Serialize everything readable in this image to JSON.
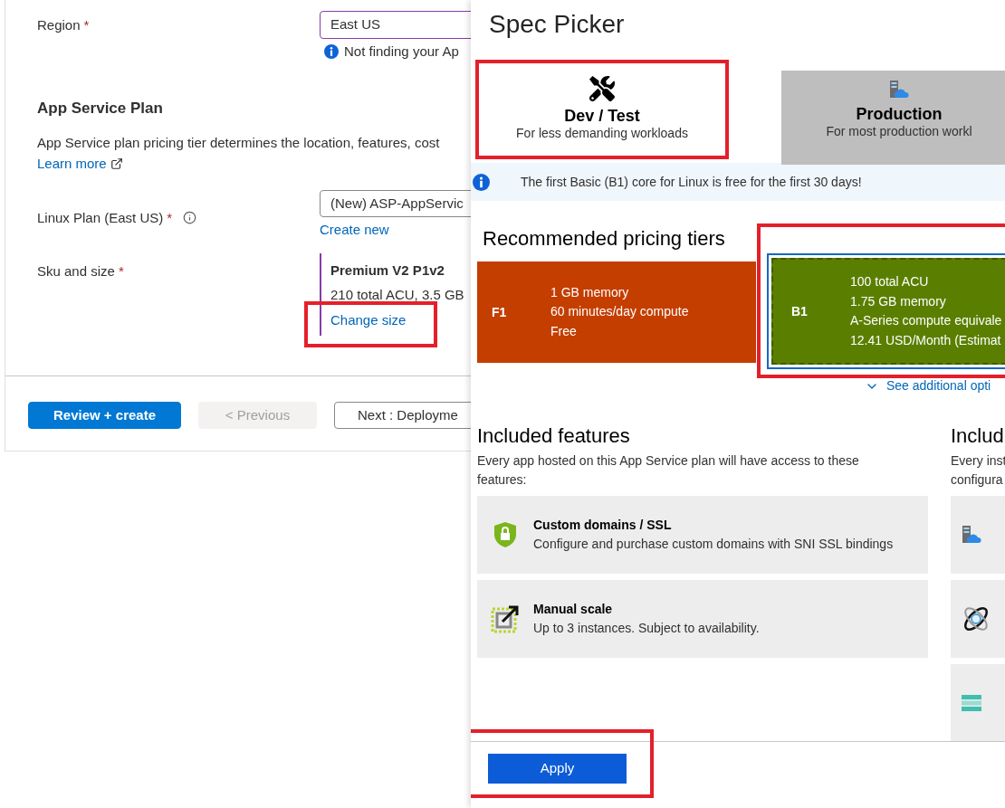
{
  "form": {
    "region": {
      "label": "Region",
      "required_mark": "*",
      "value": "East US",
      "hint": "Not finding your Ap"
    },
    "plan_section": {
      "title": "App Service Plan",
      "description": "App Service plan pricing tier determines the location, features, cost",
      "learn_more": "Learn more"
    },
    "linux_plan": {
      "label": "Linux Plan (East US)",
      "required_mark": "*",
      "value": "(New) ASP-AppServic",
      "link": "Create new"
    },
    "sku": {
      "label": "Sku and size",
      "required_mark": "*",
      "name": "Premium V2 P1v2",
      "detail": "210 total ACU, 3.5 GB",
      "link": {
        "label": "Change size",
        "highlighted": true
      }
    },
    "buttons": [
      {
        "label": "Review + create",
        "kind": "primary",
        "disabled": false
      },
      {
        "label": "< Previous",
        "kind": "secondary",
        "disabled": true
      },
      {
        "label": "Next : Deployme",
        "kind": "outline",
        "disabled": false
      }
    ]
  },
  "spec_picker": {
    "title": "Spec Picker",
    "tabs": [
      {
        "label": "Dev / Test",
        "sublabel": "For less demanding workloads",
        "kind": "tools",
        "selected": true,
        "highlighted": true
      },
      {
        "label": "Production",
        "sublabel": "For most production workl",
        "kind": "server-cloud",
        "selected": false,
        "highlighted": false
      }
    ],
    "notice": "The first Basic (B1) core for Linux is free for the first 30 days!",
    "recommended": {
      "title": "Recommended pricing tiers",
      "tiers": [
        {
          "name": "F1",
          "lines": [
            "1 GB memory",
            "60 minutes/day compute",
            "Free"
          ],
          "color": "#c43e00",
          "selected": false,
          "highlighted": false
        },
        {
          "name": "B1",
          "lines": [
            "100 total ACU",
            "1.75 GB memory",
            "A-Series compute equivale",
            "12.41 USD/Month (Estimat"
          ],
          "color": "#5a7f00",
          "selected": true,
          "highlighted": true
        }
      ],
      "more_link": "See additional opti"
    },
    "features": {
      "title": "Included features",
      "description": "Every app hosted on this App Service plan will have access to these features:",
      "items": [
        {
          "kind": "shield",
          "title": "Custom domains / SSL",
          "text": "Configure and purchase custom domains with SNI SSL bindings"
        },
        {
          "kind": "scale",
          "title": "Manual scale",
          "text": "Up to 3 instances. Subject to availability."
        }
      ]
    },
    "infrastructure": {
      "title": "Includ",
      "lines": [
        "Every inst",
        "configura"
      ],
      "items": [
        {
          "kind": "server-cloud"
        },
        {
          "kind": "orbit"
        },
        {
          "kind": "storage"
        }
      ]
    },
    "apply": {
      "label": "Apply",
      "highlighted": true
    }
  }
}
